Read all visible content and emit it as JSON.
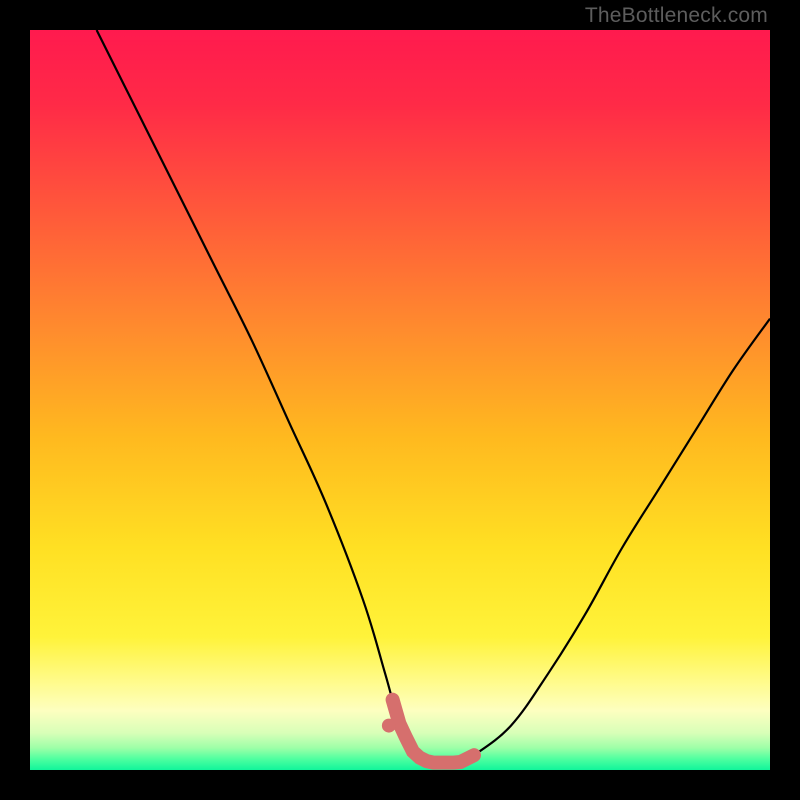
{
  "watermark": "TheBottleneck.com",
  "gradient_stops": [
    {
      "offset": 0.0,
      "color": "#ff1a4e"
    },
    {
      "offset": 0.1,
      "color": "#ff2a47"
    },
    {
      "offset": 0.25,
      "color": "#ff5a3a"
    },
    {
      "offset": 0.4,
      "color": "#ff8a2e"
    },
    {
      "offset": 0.55,
      "color": "#ffb91f"
    },
    {
      "offset": 0.7,
      "color": "#ffe023"
    },
    {
      "offset": 0.82,
      "color": "#fff33a"
    },
    {
      "offset": 0.88,
      "color": "#fffb8a"
    },
    {
      "offset": 0.92,
      "color": "#fdffc0"
    },
    {
      "offset": 0.95,
      "color": "#d8ffb8"
    },
    {
      "offset": 0.97,
      "color": "#9effa8"
    },
    {
      "offset": 0.985,
      "color": "#4fffa0"
    },
    {
      "offset": 1.0,
      "color": "#11f59b"
    }
  ],
  "chart_data": {
    "type": "line",
    "title": "",
    "xlabel": "",
    "ylabel": "",
    "xlim": [
      0,
      100
    ],
    "ylim": [
      0,
      100
    ],
    "series": [
      {
        "name": "bottleneck-curve",
        "x": [
          9,
          15,
          20,
          25,
          30,
          35,
          40,
          45,
          48,
          50,
          52,
          54,
          56,
          58,
          60,
          65,
          70,
          75,
          80,
          85,
          90,
          95,
          100
        ],
        "values": [
          100,
          88,
          78,
          68,
          58,
          47,
          36,
          23,
          13,
          6,
          2,
          1,
          1,
          1,
          2,
          6,
          13,
          21,
          30,
          38,
          46,
          54,
          61
        ]
      }
    ],
    "highlight_zone": {
      "name": "optimal-range",
      "x_start": 49,
      "x_end": 60,
      "color": "#d66f6d"
    },
    "highlight_dot": {
      "x": 48.5,
      "y": 6,
      "color": "#d66f6d"
    }
  }
}
